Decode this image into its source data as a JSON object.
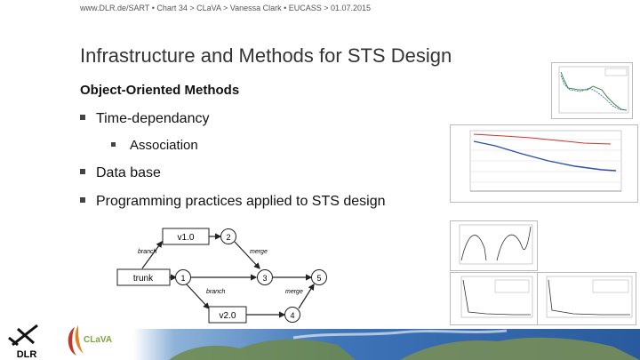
{
  "header": {
    "text": "www.DLR.de/SART  •  Chart 34    > CLaVA  > Vanessa Clark  •  EUCASS  > 01.07.2015"
  },
  "slide": {
    "title": "Infrastructure and Methods for STS Design",
    "subtitle": "Object-Oriented Methods",
    "bullets": [
      "Time-dependancy",
      "Association",
      "Data base",
      "Programming practices applied to STS design"
    ]
  },
  "diagram": {
    "nodes": {
      "v1": "v1.0",
      "trunk": "trunk",
      "v2": "v2.0",
      "n1": "1",
      "n2": "2",
      "n3": "3",
      "n4": "4",
      "n5": "5"
    },
    "edge_labels": {
      "branch_top": "branch",
      "merge_top": "merge",
      "branch_bottom": "branch",
      "merge_bottom": "merge"
    }
  },
  "logos": {
    "dlr": "DLR",
    "clava": "CLaVA"
  },
  "colors": {
    "accent_blue": "#2b4fa8",
    "accent_red": "#d23030",
    "logo_green": "#7aa83c"
  }
}
